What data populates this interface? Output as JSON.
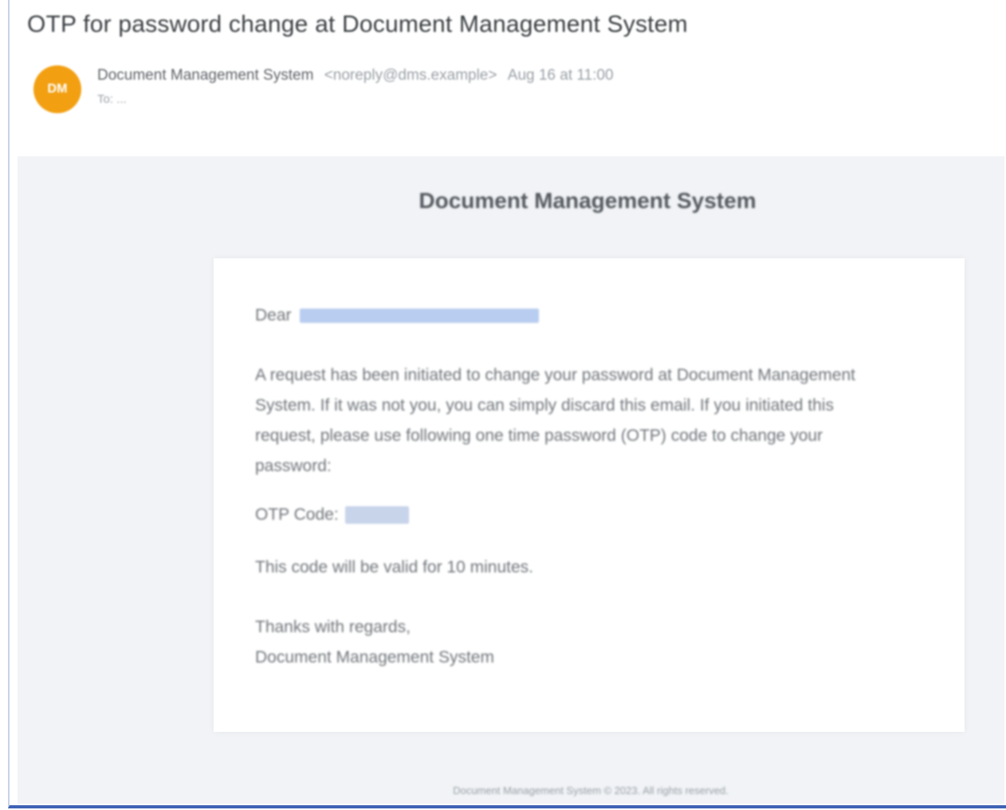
{
  "email": {
    "subject": "OTP for password change at Document Management System",
    "sender": {
      "avatar_initials": "DM",
      "name": "Document Management System",
      "email": "<noreply@dms.example>",
      "date": "Aug 16 at 11:00"
    },
    "to_label": "To: ..."
  },
  "body": {
    "brand_title": "Document Management System",
    "greeting": "Dear",
    "paragraph": "A request has been initiated to change your password at Document Management System. If it was not you, you can simply discard this email. If you initiated this request, please use following one time password (OTP) code to change your password:",
    "otp_label": "OTP Code:",
    "validity": "This code will be valid for 10 minutes.",
    "signoff_line1": "Thanks with regards,",
    "signoff_line2": "Document Management System",
    "footer": "Document Management System © 2023. All rights reserved."
  },
  "colors": {
    "avatar": "#f2a012",
    "body_background": "#f1f3f6",
    "redaction": "#b9cdf0",
    "frame_accent": "#3f62b5"
  }
}
